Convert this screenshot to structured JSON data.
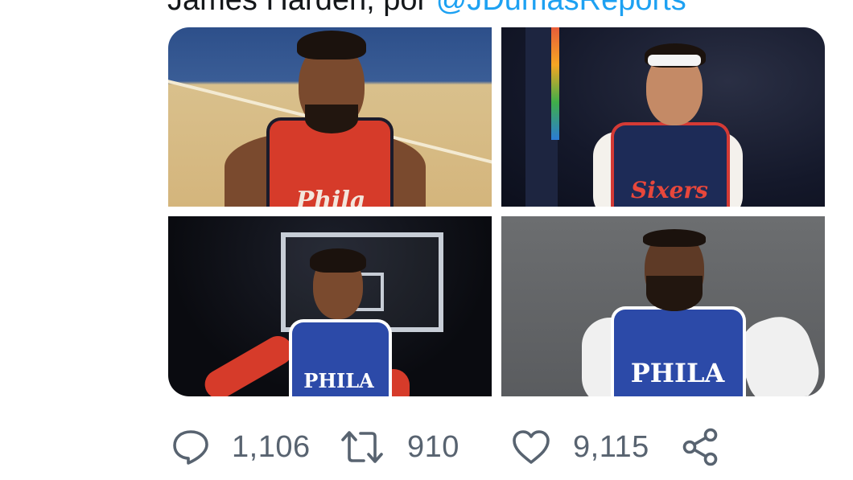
{
  "tweet": {
    "text_prefix": "James Harden, por ",
    "mention": "@JDumasReports"
  },
  "media": {
    "photos": [
      {
        "jersey_text": "Phila"
      },
      {
        "jersey_text": "Sixers"
      },
      {
        "jersey_text": "PHILA"
      },
      {
        "jersey_text": "PHILA"
      }
    ]
  },
  "actions": {
    "reply_count": "1,106",
    "retweet_count": "910",
    "like_count": "9,115"
  },
  "colors": {
    "text": "#14171a",
    "link": "#1da1f2",
    "action_gray": "#586370"
  }
}
